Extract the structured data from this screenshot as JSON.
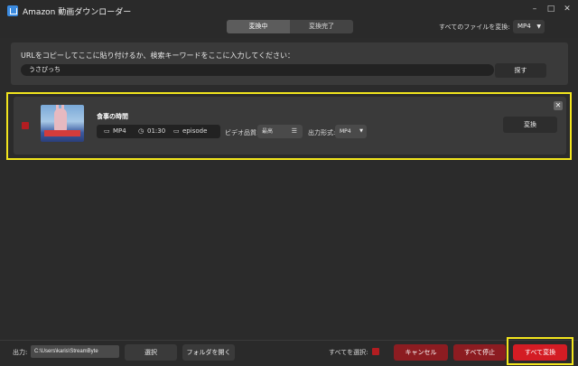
{
  "app": {
    "title": "Amazon 動画ダウンローダー"
  },
  "window_controls": {
    "minimize": "–",
    "maximize": "□",
    "close": "✕"
  },
  "tabs": [
    {
      "label": "変換中",
      "active": true
    },
    {
      "label": "変換完了",
      "active": false
    }
  ],
  "header": {
    "convert_all_label": "すべてのファイルを変換:",
    "format": "MP4"
  },
  "url_panel": {
    "prompt": "URLをコピーしてここに貼り付けるか、検索キーワードをここに入力してください：",
    "input_value": "うさぴっち",
    "search_label": "探す"
  },
  "item": {
    "title": "食事の時間",
    "format": "MP4",
    "duration": "01:30",
    "type": "episode",
    "quality_label": "ビデオ品質:",
    "quality_value": "最高",
    "output_format_label": "出力形式:",
    "output_format_value": "MP4",
    "convert_label": "変換",
    "close_glyph": "✕"
  },
  "bottom": {
    "output_label": "出力:",
    "output_path": "C:\\Users\\karis\\StreamByte",
    "select_label": "選択",
    "open_folder_label": "フォルダを開く",
    "select_all_label": "すべてを選択:",
    "cancel_label": "キャンセル",
    "stop_all_label": "すべて停止",
    "convert_all_label": "すべて変換"
  },
  "colors": {
    "accent_red": "#d41c24",
    "highlight_yellow": "#f2e51d"
  }
}
